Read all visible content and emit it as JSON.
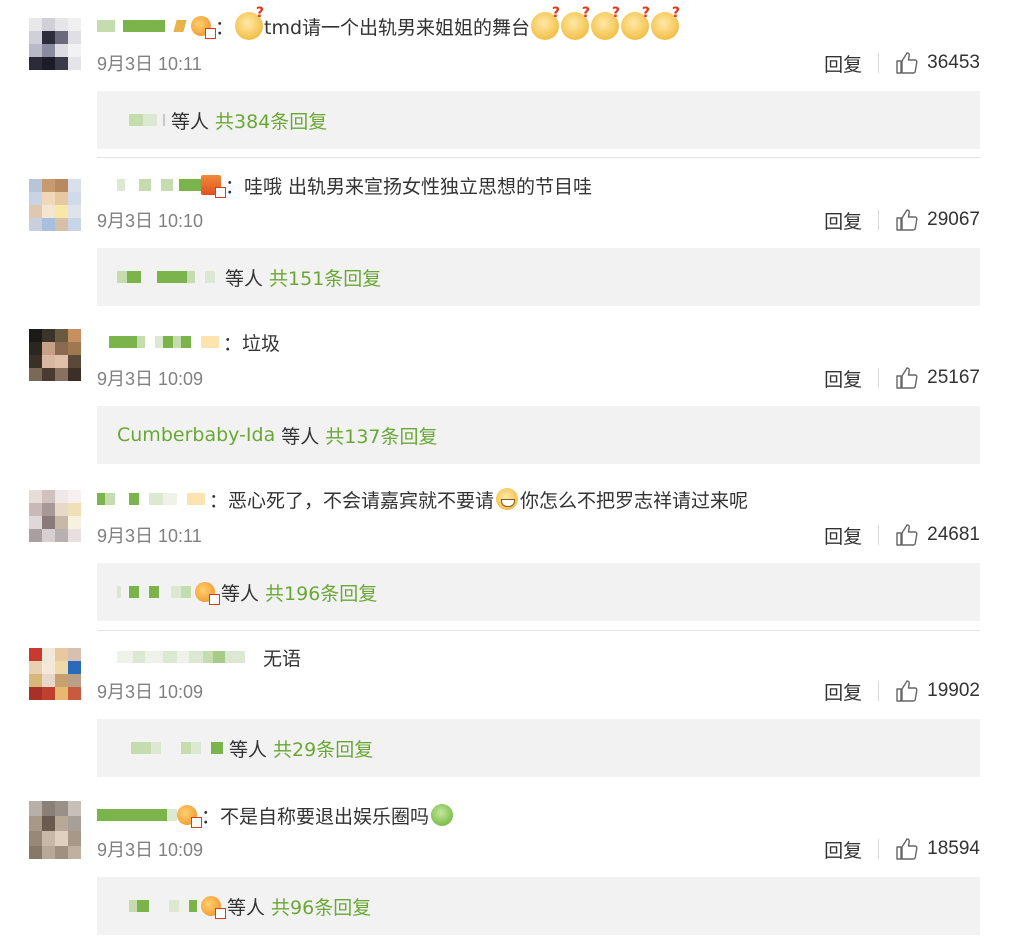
{
  "comments": [
    {
      "text": "tmd请一个出轨男来姐姐的舞台",
      "time": "9月3日 10:11",
      "reply_label": "回复",
      "likes": "36453",
      "replies": {
        "etc": "等人",
        "total": "共384条回复",
        "named_user": ""
      }
    },
    {
      "text": "：哇哦 出轨男来宣扬女性独立思想的节目哇",
      "time": "9月3日 10:10",
      "reply_label": "回复",
      "likes": "29067",
      "replies": {
        "etc": "等人",
        "total": "共151条回复",
        "named_user": ""
      }
    },
    {
      "text": "：垃圾",
      "time": "9月3日 10:09",
      "reply_label": "回复",
      "likes": "25167",
      "replies": {
        "etc": "等人",
        "total": "共137条回复",
        "named_user": "Cumberbaby-Ida"
      }
    },
    {
      "text": "：恶心死了，不会请嘉宾就不要请",
      "text_after_emoji": "你怎么不把罗志祥请过来呢",
      "time": "9月3日 10:11",
      "reply_label": "回复",
      "likes": "24681",
      "replies": {
        "etc": "等人",
        "total": "共196条回复",
        "named_user": ""
      }
    },
    {
      "text": "无语",
      "time": "9月3日 10:09",
      "reply_label": "回复",
      "likes": "19902",
      "replies": {
        "etc": "等人",
        "total": "共29条回复",
        "named_user": ""
      }
    },
    {
      "text": "：不是自称要退出娱乐圈吗",
      "time": "9月3日 10:09",
      "reply_label": "回复",
      "likes": "18594",
      "replies": {
        "etc": "等人",
        "total": "共96条回复",
        "named_user": ""
      }
    }
  ],
  "colors": {
    "accent_green": "#6aa836",
    "time_gray": "#808080",
    "reply_box_bg": "#f2f2f2"
  },
  "icons": {
    "like": "thumbs-up-icon",
    "question_emoji": "question-face-emoji",
    "sick_emoji": "nauseated-face-emoji",
    "grin_emoji": "grinning-face-emoji"
  }
}
